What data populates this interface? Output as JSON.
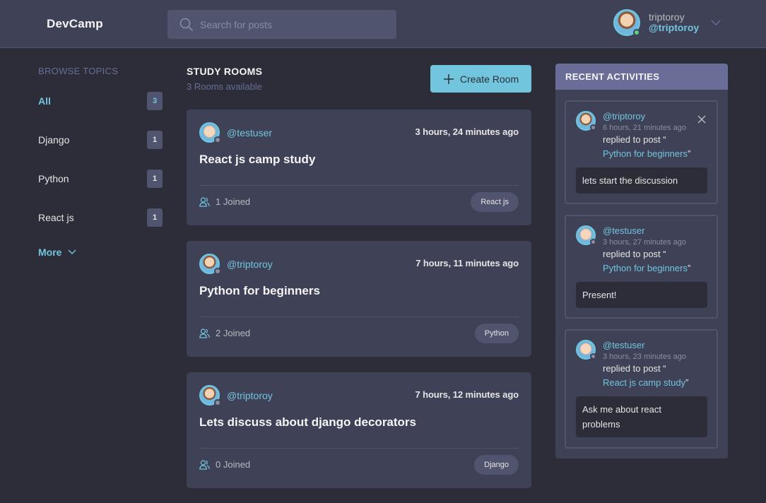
{
  "header": {
    "logo": "DevCamp",
    "search_placeholder": "Search for posts",
    "user": {
      "name": "triptoroy",
      "handle": "@triptoroy",
      "status_color": "#5bd37a"
    }
  },
  "sidebar": {
    "title": "BROWSE TOPICS",
    "topics": [
      {
        "label": "All",
        "count": "3"
      },
      {
        "label": "Django",
        "count": "1"
      },
      {
        "label": "Python",
        "count": "1"
      },
      {
        "label": "React js",
        "count": "1"
      }
    ],
    "more_label": "More"
  },
  "rooms": {
    "title": "STUDY ROOMS",
    "subtitle": "3 Rooms available",
    "create_label": "Create Room",
    "items": [
      {
        "host": "@testuser",
        "time": "3 hours, 24 minutes ago",
        "name": "React js camp study",
        "joined": "1 Joined",
        "topic": "React js"
      },
      {
        "host": "@triptoroy",
        "time": "7 hours, 11 minutes ago",
        "name": "Python for beginners",
        "joined": "2 Joined",
        "topic": "Python"
      },
      {
        "host": "@triptoroy",
        "time": "7 hours, 12 minutes ago",
        "name": "Lets discuss about django decorators",
        "joined": "0 Joined",
        "topic": "Django"
      }
    ]
  },
  "activities": {
    "title": "RECENT ACTIVITIES",
    "items": [
      {
        "user": "@triptoroy",
        "time": "6 hours, 21 minutes ago",
        "action": "replied to post “",
        "post": "Python for beginners",
        "quote_close": "”",
        "message": "lets start the discussion"
      },
      {
        "user": "@testuser",
        "time": "3 hours, 27 minutes ago",
        "action": "replied to post “",
        "post": "Python for beginners",
        "quote_close": "”",
        "message": "Present!"
      },
      {
        "user": "@testuser",
        "time": "3 hours, 23 minutes ago",
        "action": "replied to post “",
        "post": "React js camp study",
        "quote_close": "”",
        "message": "Ask me about react problems"
      }
    ]
  },
  "colors": {
    "background": "#2d2d39",
    "surface": "#3f4156",
    "accent": "#71c6dd",
    "muted": "#696d97"
  }
}
